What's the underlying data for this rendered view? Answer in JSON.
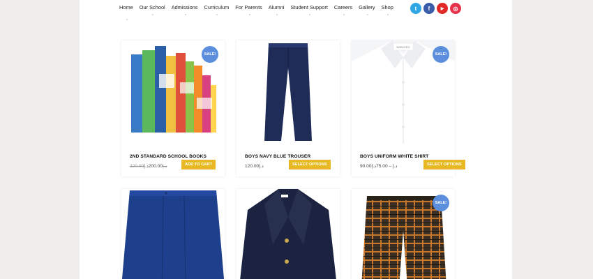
{
  "nav": {
    "items": [
      "Home",
      "Our School",
      "Admissions",
      "Curriculum",
      "For Parents",
      "Alumni",
      "Student Support",
      "Careers",
      "Gallery",
      "Shop"
    ]
  },
  "social": [
    {
      "icon": "twitter-icon",
      "glyph": "t",
      "color": "#2fa7e5"
    },
    {
      "icon": "facebook-icon",
      "glyph": "f",
      "color": "#3a5ca8"
    },
    {
      "icon": "youtube-icon",
      "glyph": "▶",
      "color": "#e12a26"
    },
    {
      "icon": "instagram-icon",
      "glyph": "◎",
      "color": "#e8324c"
    }
  ],
  "products": [
    {
      "title": "2ND STANDARD SCHOOL BOOKS",
      "old_price": "220.00د.إ",
      "price": "200.00د.إ",
      "button": "ADD TO CART",
      "sale": "SALE!"
    },
    {
      "title": "BOYS NAVY BLUE TROUSER",
      "price": "120.00د.إ",
      "button": "SELECT OPTIONS"
    },
    {
      "title": "BOYS UNIFORM WHITE SHIRT",
      "price": "90.00د.إ – 75.00د.إ",
      "button": "SELECT OPTIONS",
      "sale": "SALE!",
      "shirt_brand": "BARKERS"
    },
    {
      "title": "",
      "price": ""
    },
    {
      "title": "",
      "price": ""
    },
    {
      "title": "",
      "price": "",
      "sale": "SALE!"
    }
  ],
  "colors": {
    "accent_button": "#e8b825",
    "sale_badge": "#5b8fde"
  }
}
